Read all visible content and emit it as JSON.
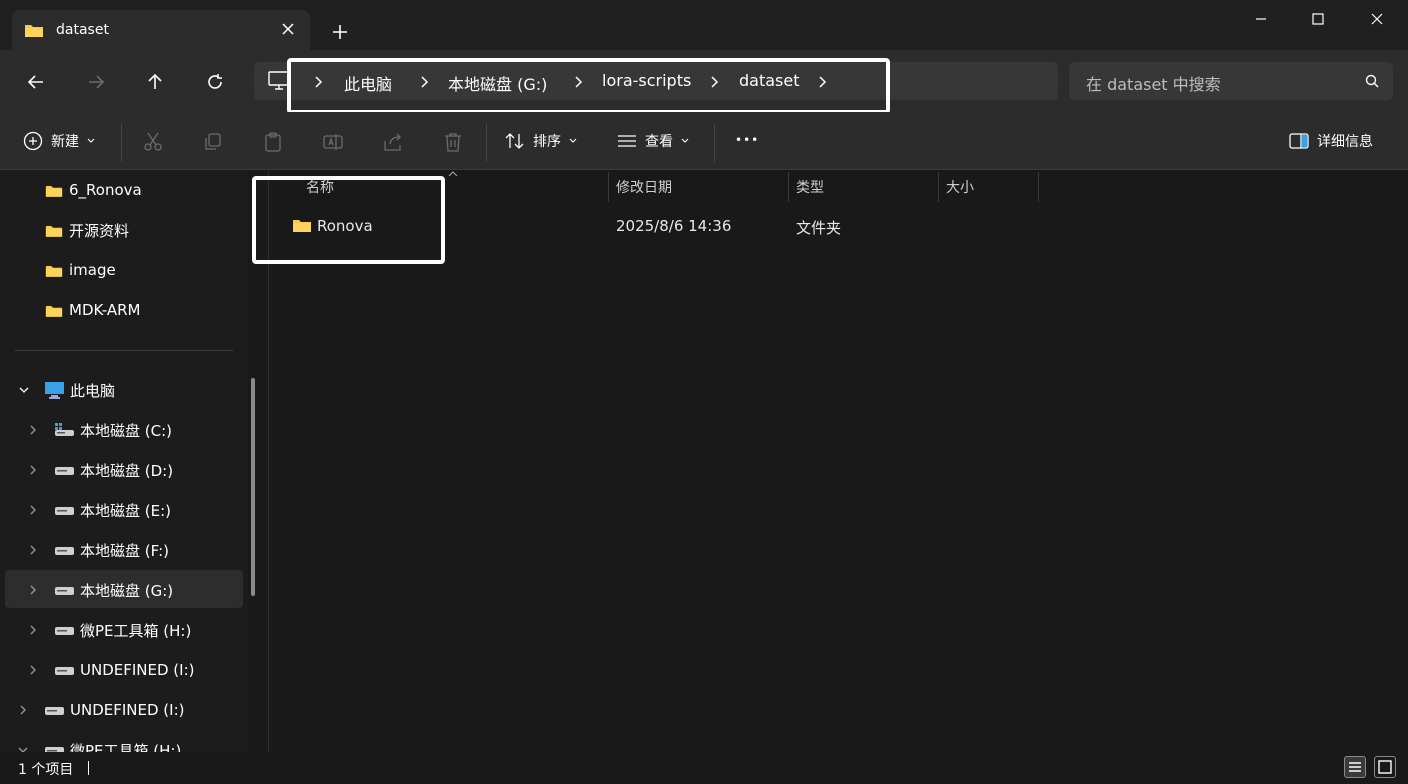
{
  "window": {
    "tab_title": "dataset",
    "new_tab": "+"
  },
  "address": {
    "crumbs": [
      "此电脑",
      "本地磁盘 (G:)",
      "lora-scripts",
      "dataset"
    ]
  },
  "search": {
    "placeholder": "在 dataset 中搜索"
  },
  "toolbar": {
    "new_label": "新建",
    "sort_label": "排序",
    "view_label": "查看",
    "more": "•••",
    "details_label": "详细信息"
  },
  "sidebar": {
    "quick_items": [
      {
        "label": "6_Ronova",
        "icon": "folder-icon"
      },
      {
        "label": "开源资料",
        "icon": "folder-icon"
      },
      {
        "label": "image",
        "icon": "folder-icon"
      },
      {
        "label": "MDK-ARM",
        "icon": "folder-icon"
      }
    ],
    "this_pc": "此电脑",
    "drives": [
      {
        "label": "本地磁盘 (C:)",
        "icon": "system-drive-icon"
      },
      {
        "label": "本地磁盘 (D:)",
        "icon": "drive-icon"
      },
      {
        "label": "本地磁盘 (E:)",
        "icon": "drive-icon"
      },
      {
        "label": "本地磁盘 (F:)",
        "icon": "drive-icon"
      },
      {
        "label": "本地磁盘 (G:)",
        "icon": "drive-icon",
        "selected": true
      },
      {
        "label": "微PE工具箱 (H:)",
        "icon": "drive-icon"
      },
      {
        "label": "UNDEFINED (I:)",
        "icon": "drive-icon"
      }
    ],
    "extra": [
      {
        "label": "UNDEFINED (I:)",
        "icon": "drive-icon"
      },
      {
        "label": "微PE工具箱 (H:)",
        "icon": "drive-icon"
      }
    ]
  },
  "columns": {
    "name": "名称",
    "modified": "修改日期",
    "type": "类型",
    "size": "大小"
  },
  "files": [
    {
      "name": "Ronova",
      "modified": "2025/8/6 14:36",
      "type": "文件夹",
      "size": ""
    }
  ],
  "status": {
    "count_text": "1 个项目"
  },
  "colors": {
    "folder": "#f7c948",
    "highlight_box": "#ffffff",
    "drive_blue": "#3aa0e8"
  }
}
